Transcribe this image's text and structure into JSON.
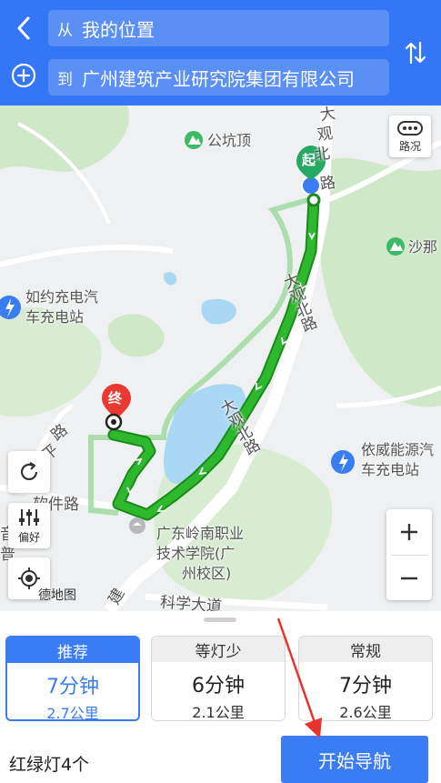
{
  "header": {
    "from_prefix": "从",
    "from_value": "我的位置",
    "to_prefix": "到",
    "to_value": "广州建筑产业研究院集团有限公司",
    "back_icon": "chevron-left-icon",
    "add_icon": "plus-circle-icon",
    "swap_icon": "swap-vertical-icon"
  },
  "map": {
    "traffic_label": "路况",
    "preference_label": "偏好",
    "start_marker": "起",
    "end_marker": "终",
    "logo_text": "德地图",
    "pois": {
      "gongkengding": "公坑顶",
      "shana": "沙那",
      "charge1_line1": "如约充电汽",
      "charge1_line2": "车充电站",
      "charge2_line1": "依威能源汽",
      "charge2_line2": "车充电站",
      "college_line1": "广东岭南职业",
      "college_line2": "技术学院(广",
      "college_line3": "州校区)"
    },
    "roads": {
      "daguan_top1": "大",
      "daguan_top2": "观",
      "daguan_top3": "北",
      "daguan_top4": "路",
      "daguan_mid": "大观北路",
      "daguan_low": "大观北路",
      "ruanjian": "软件路",
      "kexue": "科学大道",
      "left_partial": "路",
      "ping": "平",
      "jian": "建",
      "yi": "音",
      "pu": "普"
    },
    "colors": {
      "route": "#2eb82e",
      "route_border": "#1a8a1a",
      "water": "#a9d8f5",
      "green": "#cfe8c8",
      "marker_red": "#e83a30",
      "marker_green": "#27a862"
    }
  },
  "routes": [
    {
      "tag": "推荐",
      "time": "7分钟",
      "distance": "2.7公里",
      "selected": true
    },
    {
      "tag": "等灯少",
      "time": "6分钟",
      "distance": "2.1公里",
      "selected": false
    },
    {
      "tag": "常规",
      "time": "7分钟",
      "distance": "2.6公里",
      "selected": false
    }
  ],
  "footer": {
    "traffic_lights": "红绿灯4个",
    "start_nav": "开始导航"
  },
  "accent": "#3a7cf3"
}
